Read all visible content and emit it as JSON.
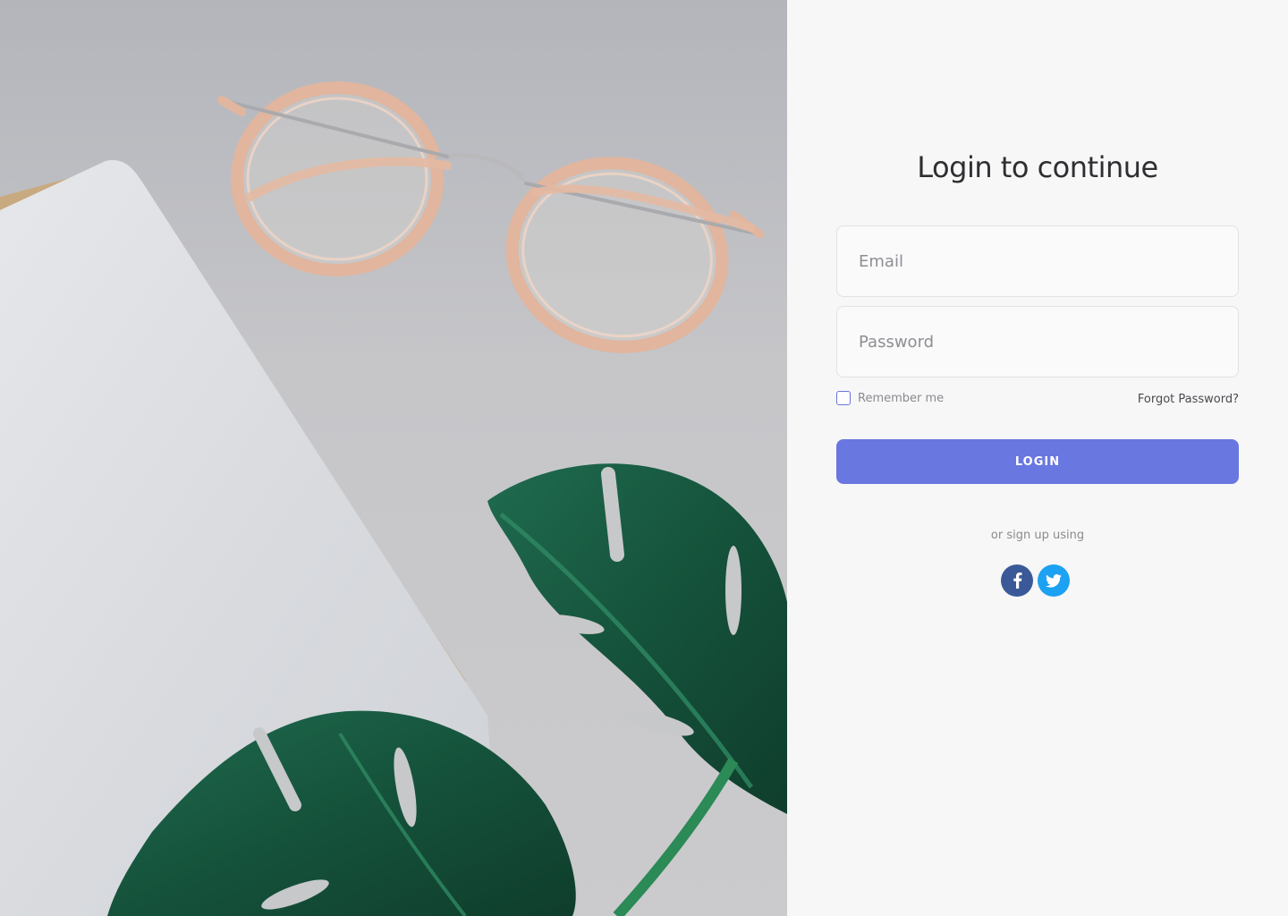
{
  "form": {
    "title": "Login to continue",
    "email": {
      "placeholder": "Email",
      "value": ""
    },
    "password": {
      "placeholder": "Password",
      "value": ""
    },
    "remember_label": "Remember me",
    "remember_checked": false,
    "forgot_label": "Forgot Password?",
    "login_label": "LOGIN",
    "alt_text": "or sign up using"
  },
  "socials": [
    {
      "name": "facebook",
      "icon": "facebook-icon",
      "color": "#3b5998"
    },
    {
      "name": "twitter",
      "icon": "twitter-icon",
      "color": "#1da1f2"
    }
  ],
  "colors": {
    "accent": "#6977e0",
    "panel_bg": "#f7f7f7",
    "checkbox_border": "#6a74d9"
  },
  "photo": {
    "subjects": [
      "glasses",
      "notebook",
      "monstera-leaves"
    ]
  }
}
